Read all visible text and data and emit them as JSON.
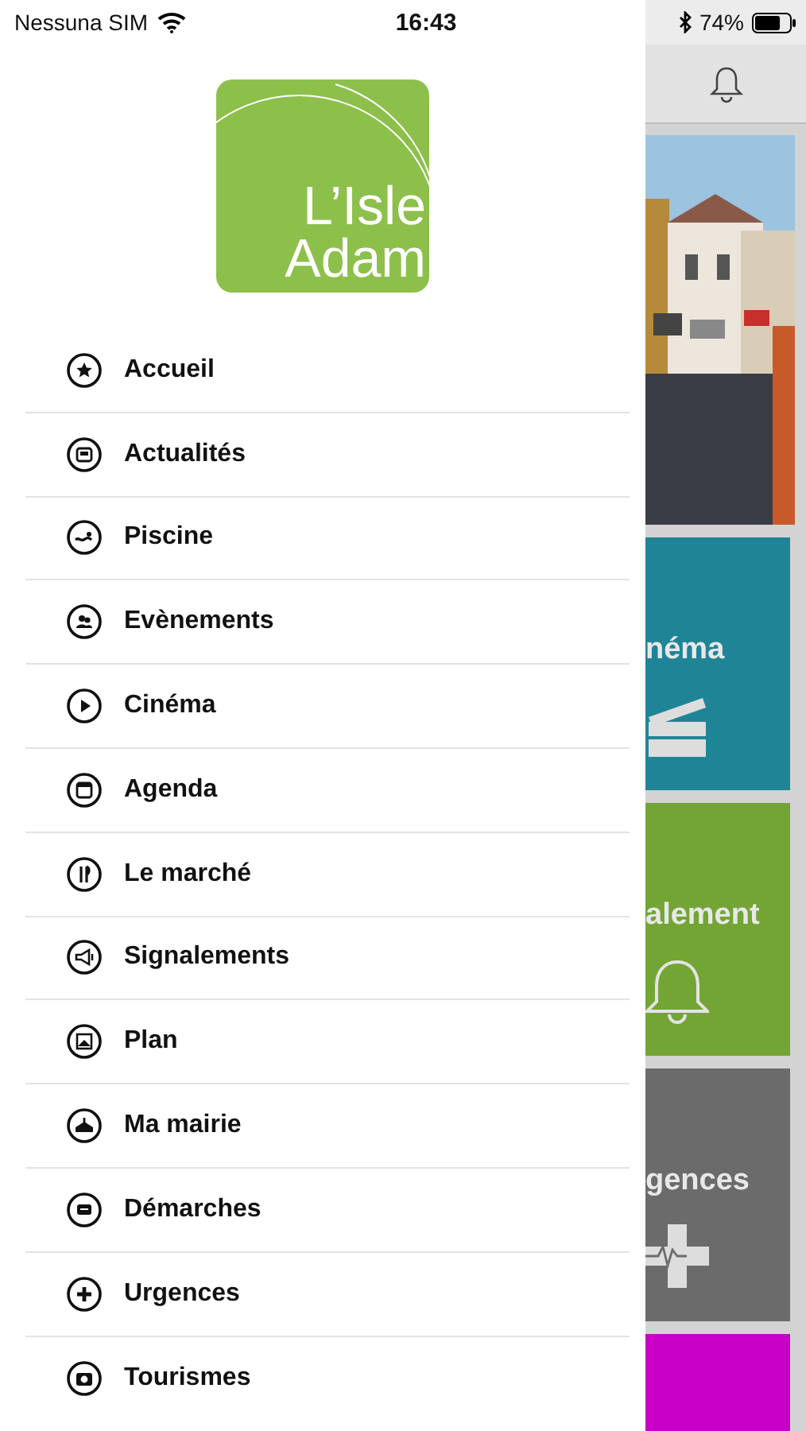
{
  "status_bar": {
    "carrier": "Nessuna SIM",
    "time": "16:43",
    "battery": "74%"
  },
  "logo": {
    "line_1": "L’Isle",
    "line_2": "Adam"
  },
  "menu": [
    {
      "label": "Accueil",
      "kind": "star"
    },
    {
      "label": "Actualités",
      "kind": "news"
    },
    {
      "label": "Piscine",
      "kind": "swim"
    },
    {
      "label": "Evènements",
      "kind": "people"
    },
    {
      "label": "Cinéma",
      "kind": "play"
    },
    {
      "label": "Agenda",
      "kind": "calendar"
    },
    {
      "label": "Le marché",
      "kind": "cutlery"
    },
    {
      "label": "Signalements",
      "kind": "megaphone"
    },
    {
      "label": "Plan",
      "kind": "map"
    },
    {
      "label": "Ma mairie",
      "kind": "townhall"
    },
    {
      "label": "Démarches",
      "kind": "chat"
    },
    {
      "label": "Urgences",
      "kind": "plus"
    },
    {
      "label": "Tourismes",
      "kind": "camera"
    }
  ],
  "tiles": [
    {
      "label": "néma",
      "color": "#1f8596",
      "kind": "clapper"
    },
    {
      "label": "alement",
      "color": "#73a534",
      "kind": "bell"
    },
    {
      "label": "gences",
      "color": "#6b6b6b",
      "kind": "cross"
    },
    {
      "color": "#c800c8",
      "kind": "none"
    }
  ]
}
